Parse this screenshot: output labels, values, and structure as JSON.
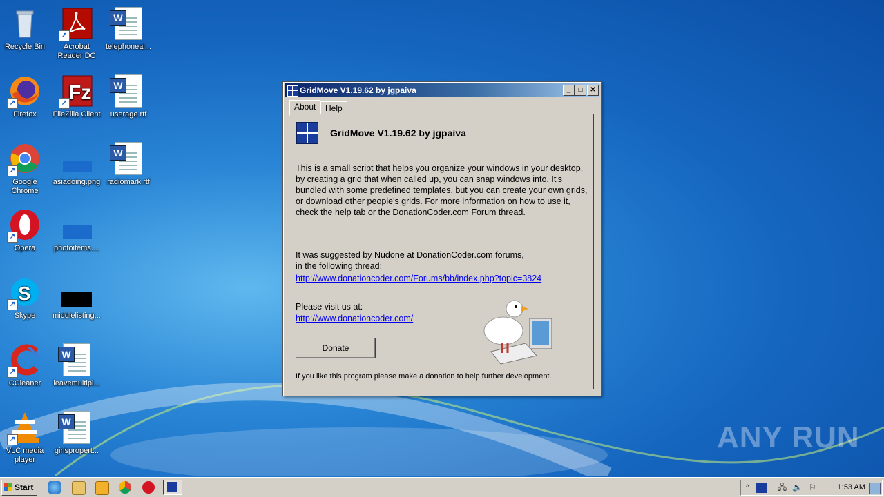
{
  "desktop": {
    "icons": [
      {
        "label": "Recycle Bin"
      },
      {
        "label": "Acrobat Reader DC"
      },
      {
        "label": "telephoneal..."
      },
      {
        "label": "Firefox"
      },
      {
        "label": "FileZilla Client"
      },
      {
        "label": "userage.rtf"
      },
      {
        "label": "Google Chrome"
      },
      {
        "label": "asiadoing.png"
      },
      {
        "label": "radiomark.rtf"
      },
      {
        "label": "Opera"
      },
      {
        "label": "photoitems...."
      },
      {
        "label": "Skype"
      },
      {
        "label": "middlelisting..."
      },
      {
        "label": "CCleaner"
      },
      {
        "label": "leavemultipl..."
      },
      {
        "label": "VLC media player"
      },
      {
        "label": "girlspropert..."
      }
    ]
  },
  "window": {
    "title": "GridMove V1.19.62 by jgpaiva",
    "buttons": {
      "minimize": "_",
      "maximize": "□",
      "close": "✕"
    },
    "tabs": [
      {
        "label": "About"
      },
      {
        "label": "Help"
      }
    ],
    "app_title": "GridMove V1.19.62 by jgpaiva",
    "description": "This is a small script that helps you organize your windows in your desktop, by creating a grid that when called up, you can snap windows into. It's bundled with some predefined templates, but you can create your own grids, or download other people's grids. For more information on how to use it, check the help tab or the DonationCoder.com Forum thread.",
    "suggestion_line1": "It was suggested by Nudone at DonationCoder.com forums,",
    "suggestion_line2": "in the following thread:",
    "forum_link": "http://www.donationcoder.com/Forums/bb/index.php?topic=3824",
    "visit_text": "Please visit us at:",
    "site_link": "http://www.donationcoder.com/",
    "donate_label": "Donate",
    "footer_note": "If you like this program please make a donation to help further development."
  },
  "watermark": "ANY RUN",
  "taskbar": {
    "start_label": "Start",
    "clock": "1:53 AM"
  },
  "colors": {
    "title_bar": "#0a246a",
    "link": "#0000ee",
    "desktop": "#1566bf"
  }
}
